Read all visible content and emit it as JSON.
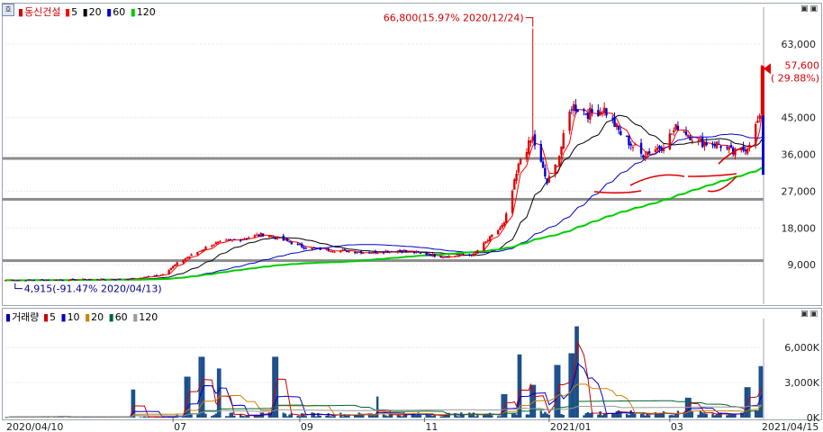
{
  "price_legend": {
    "name": "동신건설",
    "ma": [
      {
        "label": "5",
        "color": "#ff0000"
      },
      {
        "label": "20",
        "color": "#000000"
      },
      {
        "label": "60",
        "color": "#0000cc"
      },
      {
        "label": "120",
        "color": "#00cc00"
      }
    ]
  },
  "volume_legend": {
    "name": "거래량",
    "ma": [
      {
        "label": "5",
        "color": "#cc0000"
      },
      {
        "label": "10",
        "color": "#0000cc"
      },
      {
        "label": "20",
        "color": "#d08000"
      },
      {
        "label": "60",
        "color": "#006633"
      },
      {
        "label": "120",
        "color": "#999999"
      }
    ]
  },
  "corner_label": "호",
  "window_buttons": "▣▣",
  "annotations": {
    "high": "66,800(15.97% 2020/12/24)",
    "low": "4,915(-91.47% 2020/04/13)",
    "current_price": "57,600",
    "current_change": "( 29.88%)"
  },
  "chart_data": [
    {
      "type": "candlestick",
      "title": "동신건설",
      "y_ticks": [
        "63,000",
        "45,000",
        "36,000",
        "27,000",
        "18,000",
        "9,000"
      ],
      "y_tick_values": [
        63000,
        45000,
        36000,
        27000,
        18000,
        9000
      ],
      "ylim": [
        0,
        72000
      ],
      "horizontal_lines": [
        35000,
        25000,
        10000
      ],
      "x_tick_labels": [
        "2020/04/10",
        "07",
        "09",
        "11",
        "2021/01",
        "03",
        "2021/04/15"
      ],
      "x_range": [
        "2020/04/10",
        "2021/04/15"
      ],
      "annotated_high": {
        "date": "2020/12/24",
        "value": 66800
      },
      "annotated_low": {
        "date": "2020/04/13",
        "value": 4915
      },
      "last": {
        "date": "2021/04/15",
        "value": 57600,
        "change_pct": 29.88
      },
      "key_points": [
        {
          "date": "2020/04/10",
          "close": 5200
        },
        {
          "date": "2020/06/10",
          "close": 5500
        },
        {
          "date": "2020/06/25",
          "close": 6500
        },
        {
          "date": "2020/07/05",
          "close": 10000
        },
        {
          "date": "2020/07/20",
          "close": 14000
        },
        {
          "date": "2020/08/15",
          "close": 16500
        },
        {
          "date": "2020/09/05",
          "close": 13000
        },
        {
          "date": "2020/10/05",
          "close": 12000
        },
        {
          "date": "2020/10/20",
          "close": 12500
        },
        {
          "date": "2020/11/10",
          "close": 11000
        },
        {
          "date": "2020/11/25",
          "close": 11500
        },
        {
          "date": "2020/12/02",
          "close": 15000
        },
        {
          "date": "2020/12/10",
          "close": 19000
        },
        {
          "date": "2020/12/18",
          "close": 35000
        },
        {
          "date": "2020/12/24",
          "close": 40000
        },
        {
          "date": "2020/12/31",
          "close": 29000
        },
        {
          "date": "2021/01/05",
          "close": 34000
        },
        {
          "date": "2021/01/12",
          "close": 48000
        },
        {
          "date": "2021/01/20",
          "close": 46000
        },
        {
          "date": "2021/01/28",
          "close": 47000
        },
        {
          "date": "2021/02/05",
          "close": 41000
        },
        {
          "date": "2021/02/15",
          "close": 36000
        },
        {
          "date": "2021/02/25",
          "close": 38000
        },
        {
          "date": "2021/03/05",
          "close": 43000
        },
        {
          "date": "2021/03/15",
          "close": 39000
        },
        {
          "date": "2021/03/25",
          "close": 38500
        },
        {
          "date": "2021/04/02",
          "close": 36000
        },
        {
          "date": "2021/04/08",
          "close": 38000
        },
        {
          "date": "2021/04/13",
          "close": 44000
        },
        {
          "date": "2021/04/14",
          "close": 44300
        },
        {
          "date": "2021/04/15",
          "close": 57600
        }
      ]
    },
    {
      "type": "bar",
      "title": "거래량",
      "y_ticks": [
        "6,000K",
        "3,000K",
        "0K"
      ],
      "y_tick_values": [
        6000,
        3000,
        0
      ],
      "ylim": [
        0,
        8000
      ],
      "unit": "K",
      "key_points": [
        {
          "date": "2020/06/12",
          "value": 2400
        },
        {
          "date": "2020/07/08",
          "value": 3500
        },
        {
          "date": "2020/07/15",
          "value": 5200
        },
        {
          "date": "2020/07/24",
          "value": 4200
        },
        {
          "date": "2020/08/20",
          "value": 5200
        },
        {
          "date": "2020/10/10",
          "value": 1800
        },
        {
          "date": "2020/12/10",
          "value": 2000
        },
        {
          "date": "2020/12/18",
          "value": 5400
        },
        {
          "date": "2020/12/24",
          "value": 2800
        },
        {
          "date": "2021/01/05",
          "value": 4500
        },
        {
          "date": "2021/01/12",
          "value": 5500
        },
        {
          "date": "2021/01/14",
          "value": 7800
        },
        {
          "date": "2021/03/10",
          "value": 1700
        },
        {
          "date": "2021/04/08",
          "value": 2600
        },
        {
          "date": "2021/04/15",
          "value": 4400
        }
      ]
    }
  ]
}
